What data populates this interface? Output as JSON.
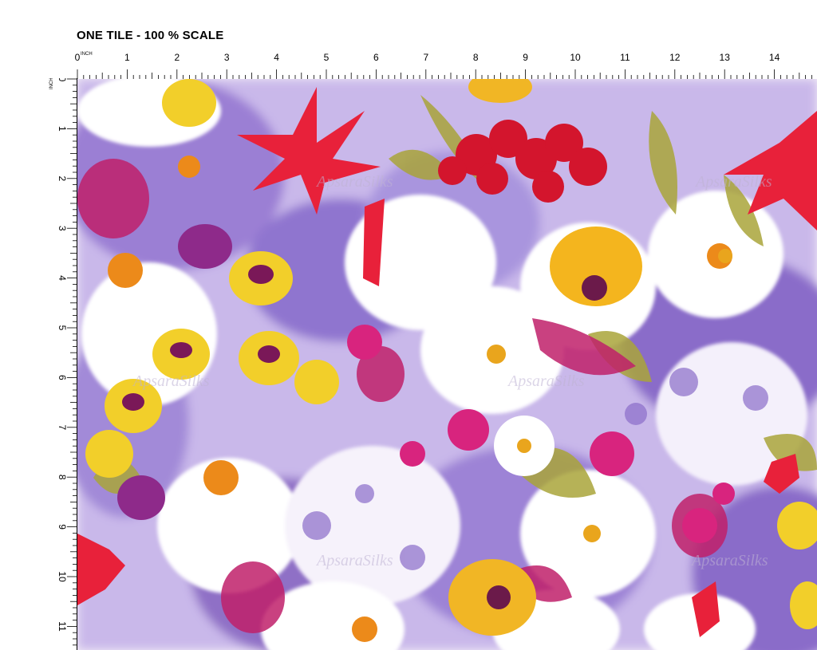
{
  "header": {
    "title": "ONE TILE - 100 % SCALE"
  },
  "ruler": {
    "unit": "INCH",
    "top_labels": [
      "0",
      "1",
      "2",
      "3",
      "4",
      "5",
      "6",
      "7",
      "8",
      "9",
      "10",
      "11",
      "12",
      "13",
      "14"
    ],
    "left_labels": [
      "0",
      "1",
      "2",
      "3",
      "4",
      "5",
      "6",
      "7",
      "8",
      "9",
      "10",
      "11"
    ]
  },
  "pattern": {
    "watermark": "ApsaraSilks",
    "palette": {
      "violet": "#8a6cc9",
      "lilac": "#b9a3e3",
      "magenta": "#c0206a",
      "red": "#e8213a",
      "yellow": "#f2cf2a",
      "orange": "#ec8a1a",
      "plum": "#6b1a4a",
      "olive": "#a9a43a",
      "white": "#ffffff"
    }
  }
}
